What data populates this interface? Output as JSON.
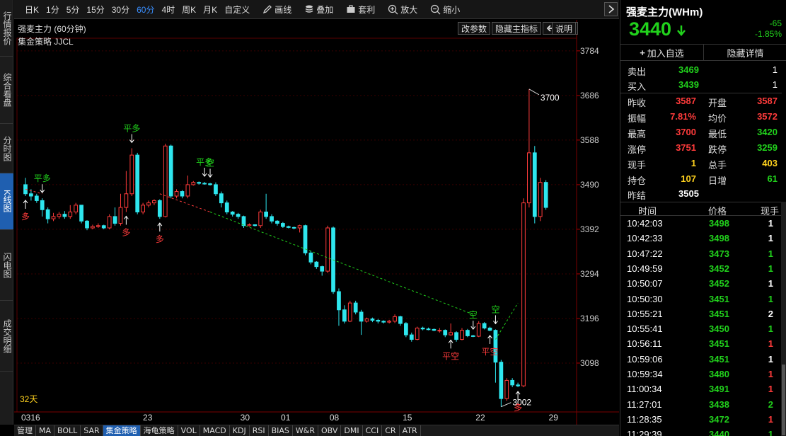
{
  "toolbar": {
    "periods": [
      "日K",
      "1分",
      "5分",
      "15分",
      "30分",
      "60分",
      "4时",
      "周K",
      "月K",
      "自定义"
    ],
    "active_period": "60分",
    "tools": [
      "画线",
      "叠加",
      "套利",
      "放大",
      "缩小"
    ]
  },
  "left_tabs": [
    "行情报价",
    "综合看盘",
    "分时图",
    "K线图",
    "闪电图",
    "成交明细"
  ],
  "active_left_tab": "K线图",
  "chart_header": {
    "title": "强麦主力 (60分钟)",
    "strategy": "集金策略 JJCL",
    "buttons": [
      "改参数",
      "隐藏主指标"
    ],
    "help": "说明"
  },
  "chart_data": {
    "type": "candlestick",
    "y_ticks": [
      3784,
      3686,
      3588,
      3490,
      3392,
      3294,
      3196,
      3098
    ],
    "ylim": [
      3000,
      3790
    ],
    "x_labels": [
      {
        "label": "0316",
        "x": 0
      },
      {
        "label": "23",
        "x": 15
      },
      {
        "label": "30",
        "x": 27
      },
      {
        "label": "01",
        "x": 32
      },
      {
        "label": "08",
        "x": 38
      },
      {
        "label": "15",
        "x": 47
      },
      {
        "label": "22",
        "x": 56
      },
      {
        "label": "29",
        "x": 65
      }
    ],
    "days_label": "32天",
    "high_label": "3700",
    "low_label": "3002",
    "candles": [
      [
        0,
        3490,
        3470,
        3505,
        3465
      ],
      [
        1,
        3470,
        3465,
        3480,
        3455
      ],
      [
        2,
        3465,
        3455,
        3470,
        3450
      ],
      [
        3,
        3455,
        3435,
        3460,
        3420
      ],
      [
        4,
        3435,
        3415,
        3440,
        3405
      ],
      [
        5,
        3415,
        3420,
        3428,
        3410
      ],
      [
        6,
        3420,
        3425,
        3430,
        3415
      ],
      [
        7,
        3425,
        3420,
        3432,
        3415
      ],
      [
        8,
        3420,
        3430,
        3445,
        3415
      ],
      [
        9,
        3430,
        3445,
        3450,
        3425
      ],
      [
        10,
        3445,
        3410,
        3445,
        3405
      ],
      [
        11,
        3410,
        3395,
        3412,
        3390
      ],
      [
        12,
        3395,
        3398,
        3402,
        3392
      ],
      [
        13,
        3398,
        3400,
        3405,
        3395
      ],
      [
        14,
        3400,
        3395,
        3402,
        3392
      ],
      [
        15,
        3395,
        3420,
        3425,
        3392
      ],
      [
        16,
        3420,
        3405,
        3440,
        3400
      ],
      [
        17,
        3405,
        3440,
        3470,
        3400
      ],
      [
        18,
        3440,
        3470,
        3520,
        3430
      ],
      [
        19,
        3470,
        3555,
        3570,
        3465
      ],
      [
        20,
        3555,
        3430,
        3560,
        3425
      ],
      [
        21,
        3430,
        3445,
        3450,
        3425
      ],
      [
        22,
        3445,
        3450,
        3455,
        3440
      ],
      [
        23,
        3450,
        3455,
        3458,
        3445
      ],
      [
        24,
        3455,
        3420,
        3458,
        3415
      ],
      [
        25,
        3420,
        3575,
        3580,
        3418
      ],
      [
        26,
        3575,
        3465,
        3578,
        3460
      ],
      [
        27,
        3465,
        3475,
        3480,
        3460
      ],
      [
        28,
        3475,
        3465,
        3478,
        3460
      ],
      [
        29,
        3465,
        3490,
        3510,
        3460
      ],
      [
        30,
        3490,
        3495,
        3498,
        3488
      ],
      [
        31,
        3495,
        3493,
        3497,
        3490
      ],
      [
        32,
        3493,
        3492,
        3496,
        3490
      ],
      [
        33,
        3492,
        3490,
        3494,
        3488
      ],
      [
        34,
        3490,
        3470,
        3495,
        3465
      ],
      [
        35,
        3470,
        3450,
        3475,
        3440
      ],
      [
        36,
        3450,
        3430,
        3455,
        3425
      ],
      [
        37,
        3430,
        3425,
        3432,
        3420
      ],
      [
        38,
        3425,
        3420,
        3428,
        3415
      ],
      [
        39,
        3420,
        3400,
        3422,
        3395
      ],
      [
        40,
        3400,
        3402,
        3405,
        3398
      ],
      [
        41,
        3402,
        3400,
        3403,
        3398
      ],
      [
        42,
        3400,
        3430,
        3435,
        3395
      ],
      [
        43,
        3430,
        3420,
        3470,
        3415
      ],
      [
        44,
        3420,
        3410,
        3425,
        3405
      ],
      [
        45,
        3410,
        3405,
        3412,
        3400
      ],
      [
        46,
        3405,
        3398,
        3408,
        3395
      ],
      [
        47,
        3398,
        3396,
        3400,
        3394
      ],
      [
        48,
        3396,
        3395,
        3398,
        3392
      ],
      [
        49,
        3395,
        3400,
        3402,
        3385
      ],
      [
        50,
        3400,
        3340,
        3402,
        3335
      ],
      [
        51,
        3340,
        3320,
        3345,
        3315
      ],
      [
        52,
        3320,
        3310,
        3322,
        3305
      ],
      [
        53,
        3310,
        3300,
        3312,
        3290
      ],
      [
        54,
        3300,
        3395,
        3400,
        3296
      ],
      [
        55,
        3395,
        3255,
        3398,
        3250
      ],
      [
        56,
        3255,
        3215,
        3262,
        3180
      ],
      [
        57,
        3215,
        3190,
        3225,
        3185
      ],
      [
        58,
        3190,
        3230,
        3235,
        3188
      ],
      [
        59,
        3230,
        3210,
        3235,
        3205
      ],
      [
        60,
        3210,
        3190,
        3215,
        3160
      ],
      [
        61,
        3190,
        3195,
        3198,
        3187
      ],
      [
        62,
        3195,
        3192,
        3198,
        3188
      ],
      [
        63,
        3192,
        3190,
        3195,
        3185
      ],
      [
        64,
        3190,
        3188,
        3192,
        3185
      ],
      [
        65,
        3188,
        3190,
        3193,
        3185
      ],
      [
        66,
        3190,
        3200,
        3205,
        3186
      ],
      [
        67,
        3200,
        3185,
        3202,
        3180
      ],
      [
        68,
        3185,
        3160,
        3188,
        3155
      ],
      [
        69,
        3160,
        3150,
        3165,
        3145
      ],
      [
        70,
        3150,
        3175,
        3178,
        3148
      ],
      [
        71,
        3175,
        3173,
        3178,
        3170
      ],
      [
        72,
        3173,
        3172,
        3176,
        3170
      ],
      [
        73,
        3172,
        3170,
        3174,
        3168
      ],
      [
        74,
        3170,
        3170,
        3175,
        3165
      ],
      [
        75,
        3170,
        3160,
        3172,
        3155
      ],
      [
        76,
        3160,
        3165,
        3185,
        3158
      ],
      [
        77,
        3165,
        3150,
        3168,
        3145
      ],
      [
        78,
        3150,
        3170,
        3175,
        3148
      ],
      [
        79,
        3170,
        3158,
        3173,
        3155
      ],
      [
        80,
        3158,
        3157,
        3160,
        3155
      ],
      [
        81,
        3157,
        3185,
        3190,
        3155
      ],
      [
        82,
        3185,
        3175,
        3188,
        3172
      ],
      [
        83,
        3175,
        3170,
        3178,
        3168
      ],
      [
        84,
        3170,
        3100,
        3172,
        3055
      ],
      [
        85,
        3100,
        3020,
        3105,
        3002
      ],
      [
        86,
        3020,
        3060,
        3065,
        3015
      ],
      [
        87,
        3060,
        3050,
        3065,
        3045
      ],
      [
        88,
        3050,
        3048,
        3055,
        3045
      ],
      [
        89,
        3048,
        3450,
        3460,
        3045
      ],
      [
        90,
        3450,
        3560,
        3700,
        3440
      ],
      [
        91,
        3560,
        3420,
        3575,
        3405
      ],
      [
        92,
        3420,
        3495,
        3505,
        3410
      ],
      [
        93,
        3495,
        3440,
        3500,
        3435
      ]
    ],
    "signals": [
      {
        "i": 3,
        "label": "平多",
        "pos": "above",
        "color": "green"
      },
      {
        "i": 0,
        "label": "多",
        "pos": "below",
        "color": "red"
      },
      {
        "i": 19,
        "label": "平多",
        "pos": "above",
        "color": "green"
      },
      {
        "i": 18,
        "label": "多",
        "pos": "below",
        "color": "red"
      },
      {
        "i": 24,
        "label": "多",
        "pos": "below",
        "color": "red"
      },
      {
        "i": 32,
        "label": "平多",
        "pos": "above",
        "color": "green"
      },
      {
        "i": 33,
        "label": "空",
        "pos": "above",
        "color": "green"
      },
      {
        "i": 76,
        "label": "平空",
        "pos": "below",
        "color": "red"
      },
      {
        "i": 80,
        "label": "空",
        "pos": "above",
        "color": "green"
      },
      {
        "i": 83,
        "label": "平空",
        "pos": "below",
        "color": "red"
      },
      {
        "i": 84,
        "label": "空",
        "pos": "above",
        "color": "green"
      },
      {
        "i": 88,
        "label": "多",
        "pos": "below",
        "color": "red"
      }
    ]
  },
  "bottom_tabs": [
    "管理",
    "MA",
    "BOLL",
    "SAR",
    "集金策略",
    "海龟策略",
    "VOL",
    "MACD",
    "KDJ",
    "RSI",
    "BIAS",
    "W&R",
    "OBV",
    "DMI",
    "CCI",
    "CR",
    "ATR"
  ],
  "active_bottom_tab": "集金策略",
  "quote": {
    "name": "强麦主力(WHm)",
    "price": "3440",
    "change": "-65",
    "change_pct": "-1.85%",
    "add_watch": "加入自选",
    "hide_detail": "隐藏详情",
    "sell_label": "卖出",
    "sell_price": "3469",
    "sell_vol": "1",
    "buy_label": "买入",
    "buy_price": "3439",
    "buy_vol": "1",
    "rows": [
      {
        "l1": "昨收",
        "v1": "3587",
        "c1": "red",
        "l2": "开盘",
        "v2": "3587",
        "c2": "red"
      },
      {
        "l1": "振幅",
        "v1": "7.81%",
        "c1": "red",
        "l2": "均价",
        "v2": "3572",
        "c2": "red"
      },
      {
        "l1": "最高",
        "v1": "3700",
        "c1": "red",
        "l2": "最低",
        "v2": "3420",
        "c2": "green"
      },
      {
        "l1": "涨停",
        "v1": "3751",
        "c1": "red",
        "l2": "跌停",
        "v2": "3259",
        "c2": "green"
      },
      {
        "l1": "现手",
        "v1": "1",
        "c1": "yellow",
        "l2": "总手",
        "v2": "403",
        "c2": "yellow"
      },
      {
        "l1": "持仓",
        "v1": "107",
        "c1": "yellow",
        "l2": "日增",
        "v2": "61",
        "c2": "green"
      }
    ],
    "settle_label": "昨结",
    "settle_value": "3505"
  },
  "ticks_header": {
    "time": "时间",
    "price": "价格",
    "vol": "现手"
  },
  "ticks": [
    {
      "t": "10:42:03",
      "p": "3498",
      "v": "1",
      "vc": "white"
    },
    {
      "t": "10:42:33",
      "p": "3498",
      "v": "1",
      "vc": "white"
    },
    {
      "t": "10:47:22",
      "p": "3473",
      "v": "1",
      "vc": "green"
    },
    {
      "t": "10:49:59",
      "p": "3452",
      "v": "1",
      "vc": "green"
    },
    {
      "t": "10:50:07",
      "p": "3452",
      "v": "1",
      "vc": "white"
    },
    {
      "t": "10:50:30",
      "p": "3451",
      "v": "1",
      "vc": "green"
    },
    {
      "t": "10:55:21",
      "p": "3451",
      "v": "2",
      "vc": "white"
    },
    {
      "t": "10:55:41",
      "p": "3450",
      "v": "1",
      "vc": "green"
    },
    {
      "t": "10:56:11",
      "p": "3451",
      "v": "1",
      "vc": "red"
    },
    {
      "t": "10:59:06",
      "p": "3451",
      "v": "1",
      "vc": "white"
    },
    {
      "t": "10:59:34",
      "p": "3480",
      "v": "1",
      "vc": "red"
    },
    {
      "t": "11:00:34",
      "p": "3491",
      "v": "1",
      "vc": "red"
    },
    {
      "t": "11:27:01",
      "p": "3438",
      "v": "2",
      "vc": "green"
    },
    {
      "t": "11:28:35",
      "p": "3472",
      "v": "1",
      "vc": "red"
    },
    {
      "t": "11:29:39",
      "p": "3440",
      "v": "1",
      "vc": "green"
    }
  ],
  "colors": {
    "up": "#ff3b3b",
    "down": "#2ee6ee",
    "signal_green": "#21d11c",
    "signal_red": "#ff3b3b",
    "grid": "#3a0000",
    "accent": "#1f5fb0"
  }
}
